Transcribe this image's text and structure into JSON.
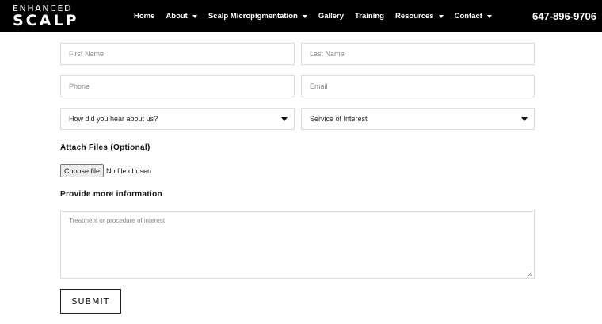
{
  "header": {
    "logo_top": "ENHANCED",
    "logo_bottom": "SCALP",
    "nav": [
      {
        "label": "Home",
        "dropdown": false
      },
      {
        "label": "About",
        "dropdown": true
      },
      {
        "label": "Scalp Micropigmentation",
        "dropdown": true
      },
      {
        "label": "Gallery",
        "dropdown": false
      },
      {
        "label": "Training",
        "dropdown": false
      },
      {
        "label": "Resources",
        "dropdown": true
      },
      {
        "label": "Contact",
        "dropdown": true
      }
    ],
    "phone": "647-896-9706"
  },
  "form": {
    "first_name_placeholder": "First Name",
    "last_name_placeholder": "Last Name",
    "phone_placeholder": "Phone",
    "email_placeholder": "Email",
    "hear_about_select": "How did you hear about us?",
    "service_select": "Service of Interest",
    "attach_label": "Attach Files (Optional)",
    "choose_file_button": "Choose file",
    "file_status": "No file chosen",
    "more_info_label": "Provide more information",
    "textarea_placeholder": "Treatment or procedure of interest",
    "submit_label": "SUBMIT"
  },
  "colors": {
    "header_bg": "#000000",
    "border": "#dcdcdc"
  }
}
